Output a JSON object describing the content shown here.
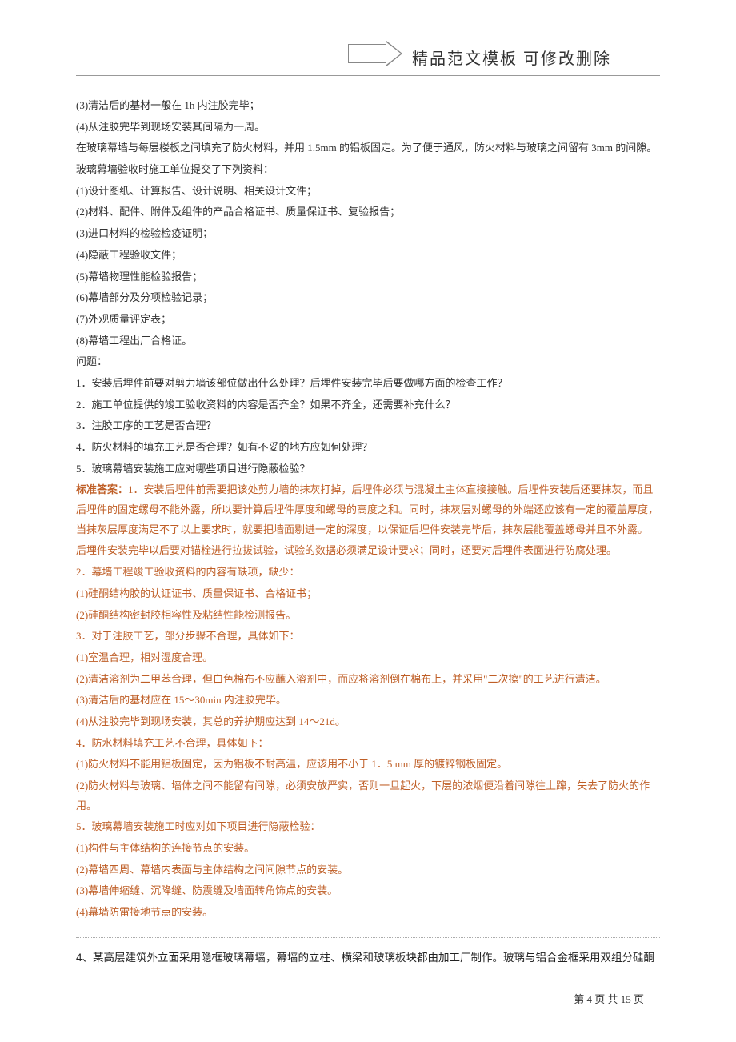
{
  "header": {
    "title": "精品范文模板  可修改删除"
  },
  "black_lines": [
    "(3)清洁后的基材一般在 1h 内注胶完毕；",
    "(4)从注胶完毕到现场安装其间隔为一周。",
    "在玻璃幕墙与每层楼板之间填充了防火材料，并用 1.5mm 的铝板固定。为了便于通风，防火材料与玻璃之间留有 3mm 的间隙。",
    "玻璃幕墙验收时施工单位提交了下列资料：",
    "(1)设计图纸、计算报告、设计说明、相关设计文件；",
    "(2)材料、配件、附件及组件的产品合格证书、质量保证书、复验报告；",
    "(3)进口材料的检验检疫证明；",
    "(4)隐蔽工程验收文件；",
    "(5)幕墙物理性能检验报告；",
    "(6)幕墙部分及分项检验记录；",
    "(7)外观质量评定表；",
    "(8)幕墙工程出厂合格证。",
    "问题：",
    "1．安装后埋件前要对剪力墙该部位做出什么处理？后埋件安装完毕后要做哪方面的检查工作？",
    "2．施工单位提供的竣工验收资料的内容是否齐全？如果不齐全，还需要补充什么？",
    "3．注胶工序的工艺是否合理？",
    "4．防火材料的填充工艺是否合理？如有不妥的地方应如何处理？",
    "5．玻璃幕墙安装施工应对哪些项目进行隐蔽检验？"
  ],
  "answer_prefix": "标准答案：",
  "brown_lines": [
    "1．安装后埋件前需要把该处剪力墙的抹灰打掉，后埋件必须与混凝土主体直接接触。后埋件安装后还要抹灰，而且后埋件的固定螺母不能外露，所以要计算后埋件厚度和螺母的高度之和。同时，抹灰层对螺母的外端还应该有一定的覆盖厚度，当抹灰层厚度满足不了以上要求时，就要把墙面剔进一定的深度，以保证后埋件安装完毕后，抹灰层能覆盖螺母并且不外露。",
    "后埋件安装完毕以后要对锚栓进行拉拔试验，试验的数据必须满足设计要求；同时，还要对后埋件表面进行防腐处理。",
    "2．幕墙工程竣工验收资料的内容有缺项，缺少：",
    "(1)硅酮结构胶的认证证书、质量保证书、合格证书；",
    "(2)硅酮结构密封胶相容性及粘结性能检测报告。",
    "3．对于注胶工艺，部分步骤不合理，具体如下：",
    "(1)室温合理，相对湿度合理。",
    "(2)清洁溶剂为二甲苯合理，但白色棉布不应蘸入溶剂中，而应将溶剂倒在棉布上，并采用\"二次擦\"的工艺进行清洁。",
    "(3)清洁后的基材应在 15～30min 内注胶完毕。",
    "(4)从注胶完毕到现场安装，其总的养护期应达到 14～21d。",
    "4．防水材料填充工艺不合理，具体如下：",
    "(1)防火材料不能用铝板固定，因为铝板不耐高温，应该用不小于 1．5 mm 厚的镀锌钢板固定。",
    "(2)防火材料与玻璃、墙体之间不能留有间隙，必须安放严实，否则一旦起火，下层的浓烟便沿着间隙往上蹿，失去了防火的作用。",
    "5．玻璃幕墙安装施工时应对如下项目进行隐蔽检验：",
    "(1)构件与主体结构的连接节点的安装。",
    "(2)幕墙四周、幕墙内表面与主体结构之间间隙节点的安装。",
    "(3)幕墙伸缩缝、沉降缝、防震缝及墙面转角饰点的安装。",
    "(4)幕墙防雷接地节点的安装。"
  ],
  "question4": "4、某高层建筑外立面采用隐框玻璃幕墙，幕墙的立柱、横梁和玻璃板块都由加工厂制作。玻璃与铝合金框采用双组分硅酮",
  "footer": {
    "text_prefix": "第 ",
    "page": "4",
    "text_mid": " 页 共 ",
    "total": "15",
    "text_suffix": " 页"
  }
}
